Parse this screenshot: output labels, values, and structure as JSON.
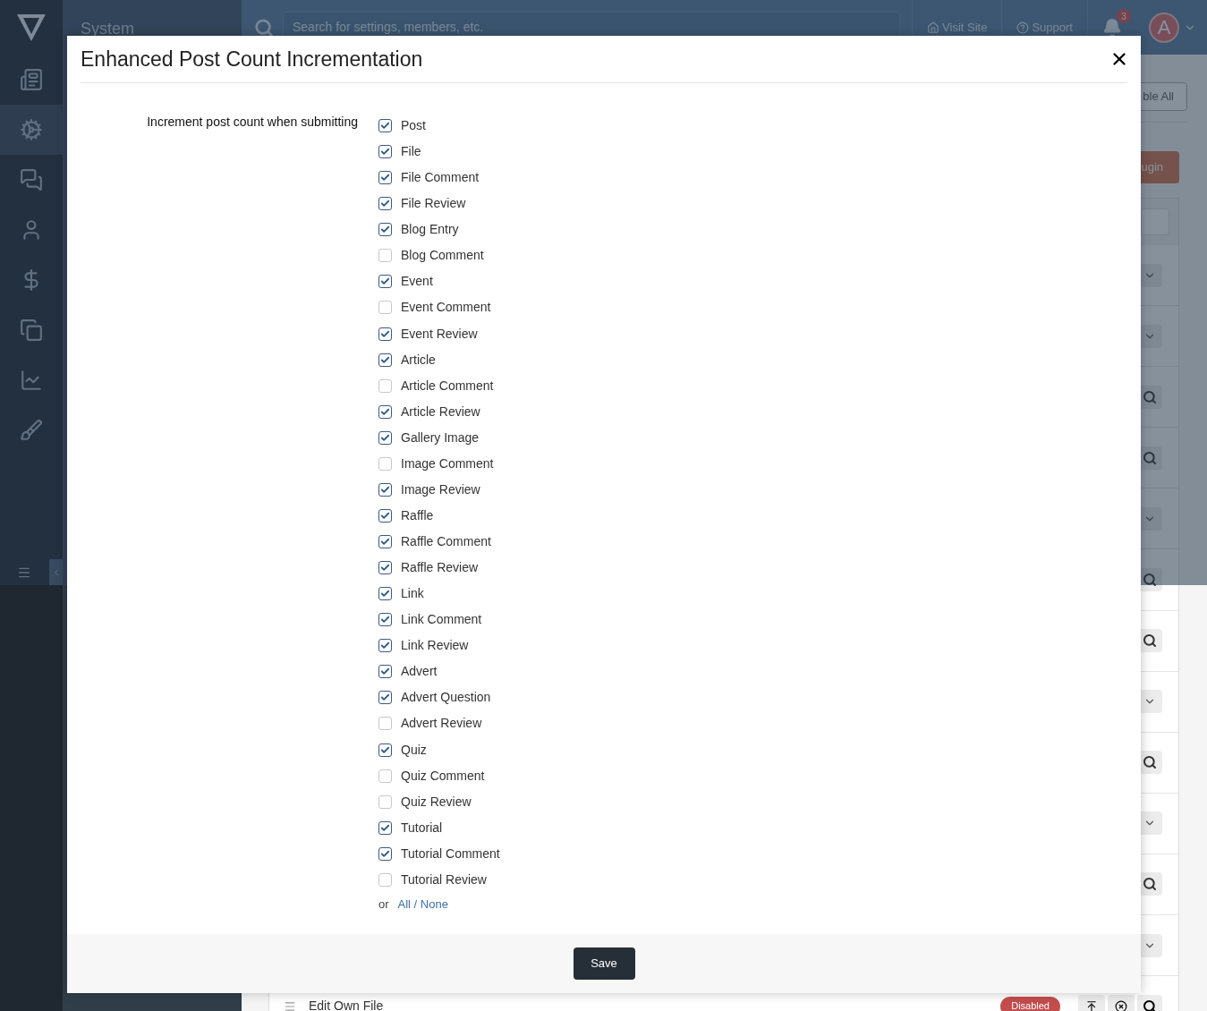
{
  "sidebar": {
    "items": [
      {
        "selected": false
      },
      {
        "selected": true
      },
      {
        "selected": false
      },
      {
        "selected": false
      },
      {
        "selected": false
      },
      {
        "selected": false
      },
      {
        "selected": false
      },
      {
        "selected": false
      }
    ]
  },
  "section_title": "System",
  "topbar": {
    "search": {
      "placeholder": "Search for settings, members, etc."
    },
    "links": [
      "Visit Site",
      "Support"
    ],
    "notification_count": "3",
    "avatar_letter": "A"
  },
  "page": {
    "top_button": "ble All",
    "action_button": "ugin",
    "rows": [
      {
        "kind": "expand"
      },
      {
        "kind": "expand"
      },
      {
        "kind": "search"
      },
      {
        "kind": "search"
      },
      {
        "kind": "expand"
      },
      {
        "kind": "search"
      },
      {
        "kind": "search"
      },
      {
        "kind": "expand"
      },
      {
        "kind": "search"
      },
      {
        "kind": "expand"
      },
      {
        "kind": "search"
      },
      {
        "kind": "expand"
      },
      {
        "kind": "item",
        "title": "Edit Own File",
        "badge": "Disabled"
      }
    ]
  },
  "dialog": {
    "title": "Enhanced Post Count Incrementation",
    "field_label": "Increment post count when submitting",
    "options": [
      {
        "label": "Post",
        "checked": true
      },
      {
        "label": "File",
        "checked": true
      },
      {
        "label": "File Comment",
        "checked": true
      },
      {
        "label": "File Review",
        "checked": true
      },
      {
        "label": "Blog Entry",
        "checked": true
      },
      {
        "label": "Blog Comment",
        "checked": false
      },
      {
        "label": "Event",
        "checked": true
      },
      {
        "label": "Event Comment",
        "checked": false
      },
      {
        "label": "Event Review",
        "checked": true
      },
      {
        "label": "Article",
        "checked": true
      },
      {
        "label": "Article Comment",
        "checked": false
      },
      {
        "label": "Article Review",
        "checked": true
      },
      {
        "label": "Gallery Image",
        "checked": true
      },
      {
        "label": "Image Comment",
        "checked": false
      },
      {
        "label": "Image Review",
        "checked": true
      },
      {
        "label": "Raffle",
        "checked": true
      },
      {
        "label": "Raffle Comment",
        "checked": true
      },
      {
        "label": "Raffle Review",
        "checked": true
      },
      {
        "label": "Link",
        "checked": true
      },
      {
        "label": "Link Comment",
        "checked": true
      },
      {
        "label": "Link Review",
        "checked": true
      },
      {
        "label": "Advert",
        "checked": true
      },
      {
        "label": "Advert Question",
        "checked": true
      },
      {
        "label": "Advert Review",
        "checked": false
      },
      {
        "label": "Quiz",
        "checked": true
      },
      {
        "label": "Quiz Comment",
        "checked": false
      },
      {
        "label": "Quiz Review",
        "checked": false
      },
      {
        "label": "Tutorial",
        "checked": true
      },
      {
        "label": "Tutorial Comment",
        "checked": true
      },
      {
        "label": "Tutorial Review",
        "checked": false
      }
    ],
    "select_prefix": "or",
    "select_link": "All / None",
    "save_button": "Save"
  }
}
